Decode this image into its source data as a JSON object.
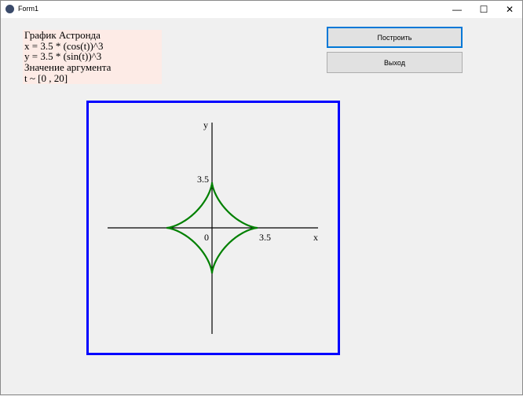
{
  "window": {
    "title": "Form1",
    "minimize": "—",
    "maximize": "☐",
    "close": "✕"
  },
  "info": {
    "lines": [
      "График Астронда",
      "x = 3.5 * (cos(t))^3",
      "y = 3.5 * (sin(t))^3",
      "Значение аргумента",
      "t ~ [0 , 20]"
    ]
  },
  "buttons": {
    "build": "Построить",
    "exit": "Выход"
  },
  "plot": {
    "x_label": "x",
    "y_label": "y",
    "origin_label": "0",
    "x_tick": "3.5",
    "y_tick": "3.5",
    "a": 3.5,
    "t_range": [
      0,
      20
    ],
    "curve_color": "#008000",
    "frame_color": "#0000ff"
  }
}
